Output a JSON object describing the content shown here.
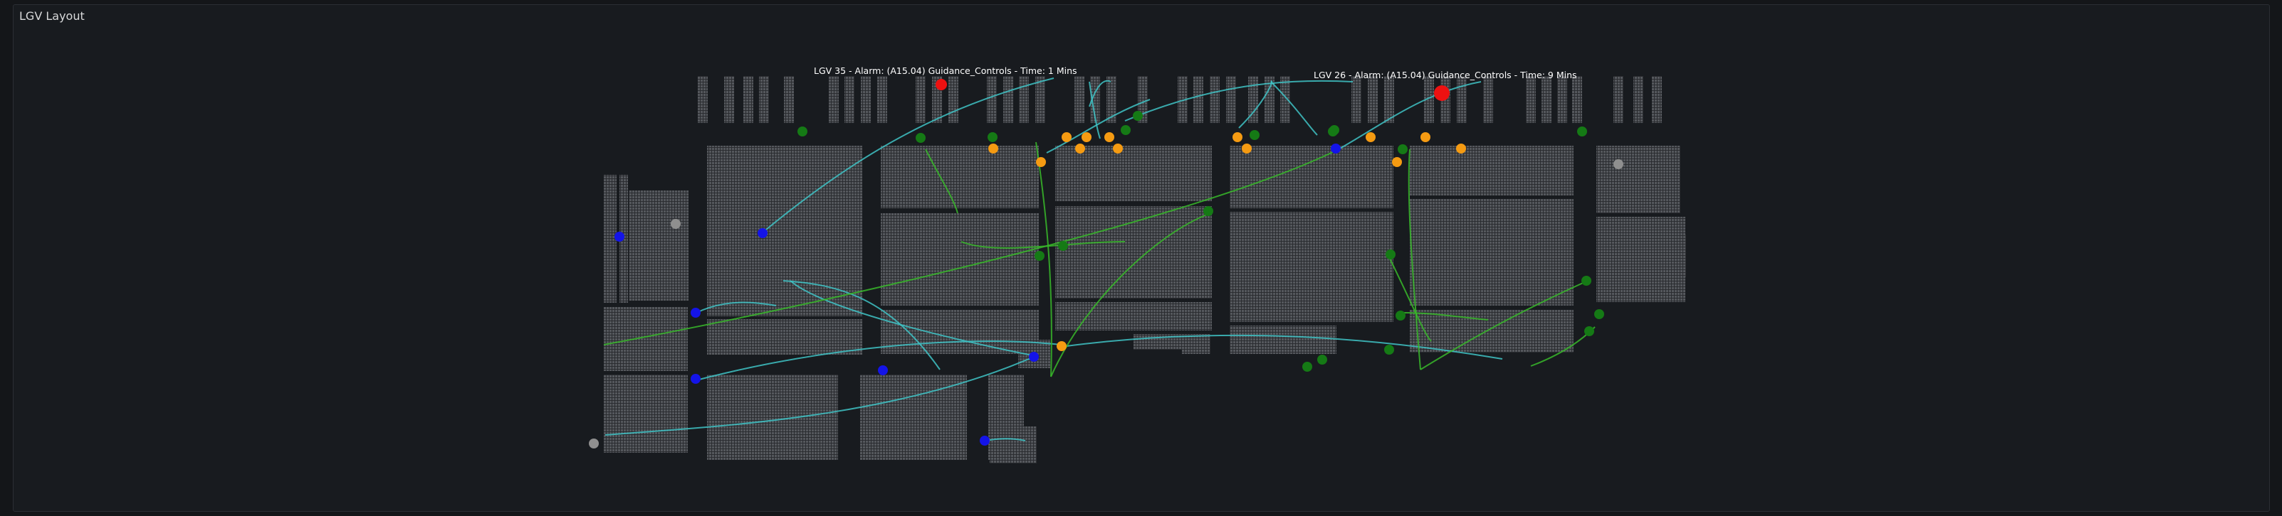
{
  "panel": {
    "title": "LGV Layout"
  },
  "alarms": [
    {
      "text": "LGV 35 - Alarm: (A15.04) Guidance_Controls    - Time: 1 Mins"
    },
    {
      "text": "LGV 26 - Alarm: (A15.04) Guidance_Controls    - Time: 9 Mins"
    }
  ],
  "legend_colors": {
    "background": "#181b1f",
    "rack": "#4a4d52",
    "path_cyan": "#3fc3c6",
    "path_green": "#38b82a",
    "lgv_blue": "#1414e8",
    "lgv_green": "#157a15",
    "lgv_orange": "#f59b12",
    "lgv_grey": "#8f8f8f",
    "lgv_alarm": "#ee1111"
  }
}
